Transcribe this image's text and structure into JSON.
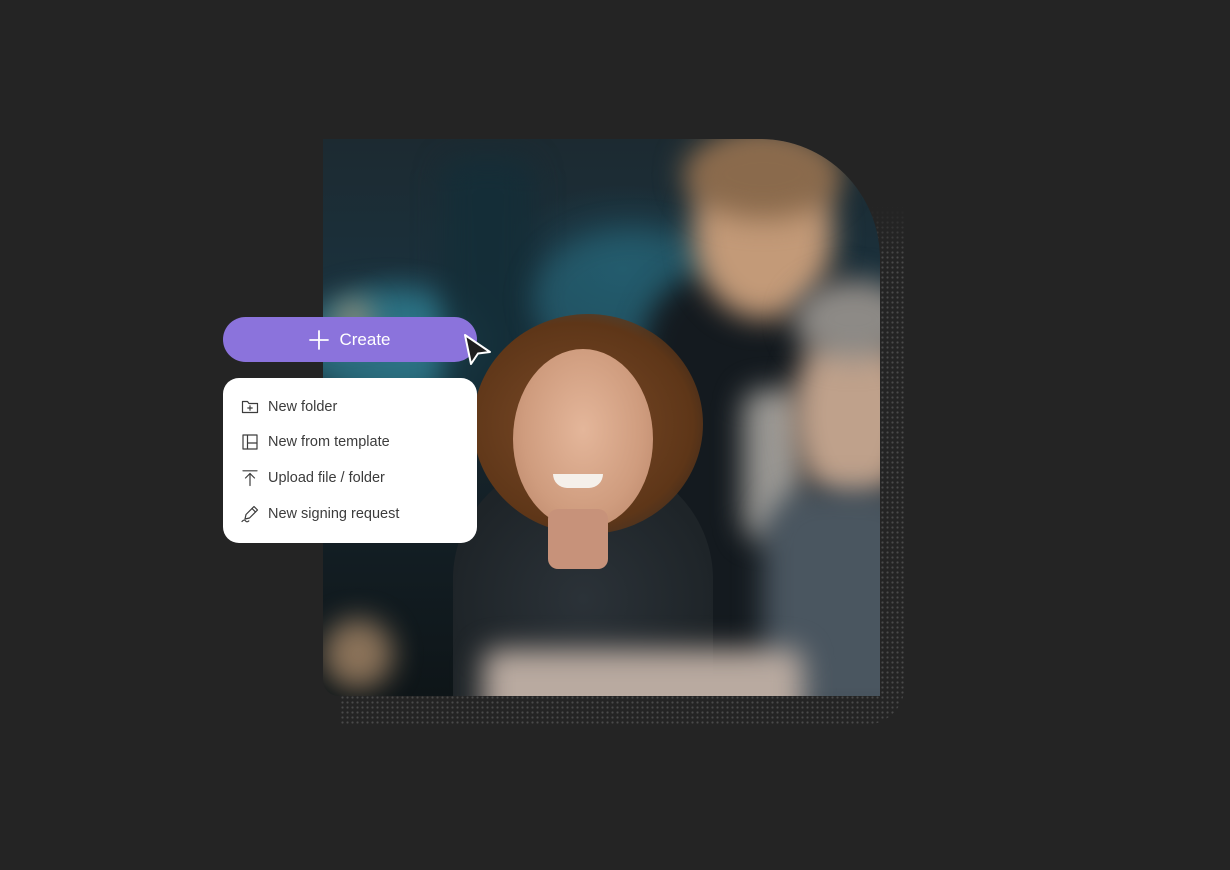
{
  "create_button": {
    "label": "Create",
    "icon": "plus-icon",
    "color": "#8b73dc"
  },
  "menu": {
    "items": [
      {
        "label": "New folder",
        "icon": "folder-plus-icon"
      },
      {
        "label": "New from template",
        "icon": "template-icon"
      },
      {
        "label": "Upload file / folder",
        "icon": "upload-icon"
      },
      {
        "label": "New signing request",
        "icon": "signature-pen-icon"
      }
    ]
  },
  "hero_image": {
    "icon": "team-photo"
  },
  "colors": {
    "background": "#242424",
    "accent": "#8b73dc",
    "menu_background": "#ffffff",
    "menu_text": "#3c3c3c"
  }
}
